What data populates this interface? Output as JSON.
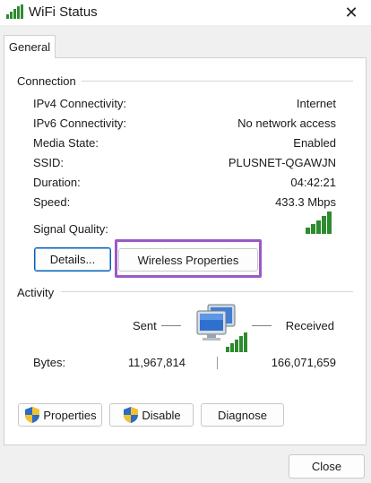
{
  "window": {
    "title": "WiFi Status",
    "close_glyph": "✕"
  },
  "tabs": [
    {
      "label": "General"
    }
  ],
  "connection": {
    "label": "Connection",
    "rows": [
      {
        "label": "IPv4 Connectivity:",
        "value": "Internet"
      },
      {
        "label": "IPv6 Connectivity:",
        "value": "No network access"
      },
      {
        "label": "Media State:",
        "value": "Enabled"
      },
      {
        "label": "SSID:",
        "value": "PLUSNET-QGAWJN"
      },
      {
        "label": "Duration:",
        "value": "04:42:21"
      },
      {
        "label": "Speed:",
        "value": "433.3 Mbps"
      }
    ],
    "signal_label": "Signal Quality:",
    "signal_bars": 5,
    "signal_color": "#2e8b2e"
  },
  "buttons": {
    "details": "Details...",
    "wireless_properties": "Wireless Properties",
    "properties": "Properties",
    "disable": "Disable",
    "diagnose": "Diagnose",
    "close": "Close"
  },
  "activity": {
    "label": "Activity",
    "sent_label": "Sent",
    "received_label": "Received",
    "bytes_label": "Bytes:",
    "bytes_sent": "11,967,814",
    "bytes_received": "166,071,659"
  },
  "colors": {
    "highlight": "#9b59c6",
    "accent": "#005fb8",
    "shield_blue": "#2b6cc4",
    "shield_yellow": "#f2c230"
  }
}
